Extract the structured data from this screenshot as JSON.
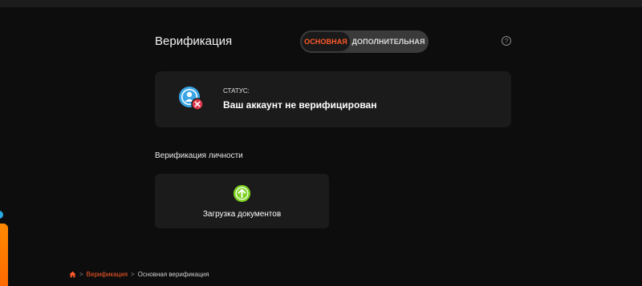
{
  "header": {
    "title": "Верификация"
  },
  "tabs": [
    {
      "label": "ОСНОВНАЯ",
      "active": true
    },
    {
      "label": "ДОПОЛНИТЕЛЬНАЯ",
      "active": false
    }
  ],
  "help": {
    "symbol": "?"
  },
  "status": {
    "label": "СТАТУС:",
    "text": "Ваш аккаунт не верифицирован",
    "icon": "user-unverified-icon"
  },
  "identity": {
    "title": "Верификация личности",
    "upload_label": "Загрузка документов",
    "upload_icon": "arrow-up-circle-icon"
  },
  "breadcrumb": {
    "home_icon": "home-icon",
    "separator": ">",
    "items": [
      "Верификация",
      "Основная верификация"
    ]
  },
  "colors": {
    "accent": "#ff5a2a",
    "upload_green": "#7ed321",
    "status_blue": "#3aa6e6",
    "error_red": "#e0384c"
  }
}
